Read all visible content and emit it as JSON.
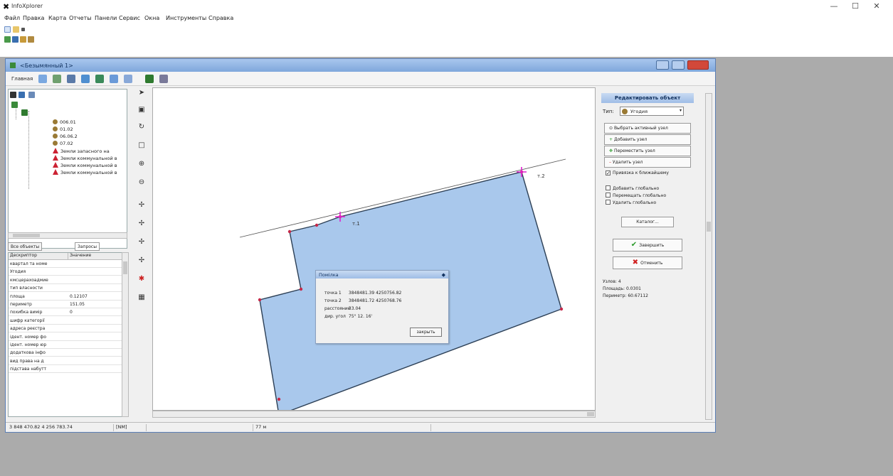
{
  "app": {
    "title": "InfoXplorer",
    "window_controls": [
      "—",
      "☐",
      "✕"
    ]
  },
  "menu": [
    "Файл",
    "Правка",
    "Карта",
    "Отчеты",
    "Панели",
    "Сервис",
    "Окна",
    "Инструменты",
    "Справка"
  ],
  "mdi": {
    "title": "<Безымянный 1>",
    "toolbar_label": "Главная"
  },
  "tree": {
    "nodes": [
      "006.01",
      "01.02",
      "06.06.2",
      "07.02",
      "Земли запасного на",
      "Земли коммунальной в",
      "Земли коммунальной в",
      "Земли коммунальной в"
    ],
    "tabs": [
      "Все объекты",
      "Запросы"
    ]
  },
  "props": {
    "headers": [
      "Дескриптор",
      "Значение"
    ],
    "rows": [
      {
        "key": "квартал та номе",
        "value": ""
      },
      {
        "key": "Угодия",
        "value": ""
      },
      {
        "key": "кмсцерахоадмие",
        "value": ""
      },
      {
        "key": "тип власности",
        "value": ""
      },
      {
        "key": "площа",
        "value": "0.12107"
      },
      {
        "key": "периметр",
        "value": "151.05"
      },
      {
        "key": "похибка вимір",
        "value": "0"
      },
      {
        "key": "шифр категорії",
        "value": ""
      },
      {
        "key": "адреса реєстра",
        "value": ""
      },
      {
        "key": "ідент. номер фо",
        "value": ""
      },
      {
        "key": "ідент. номер юр",
        "value": ""
      },
      {
        "key": "додаткова інфо",
        "value": ""
      },
      {
        "key": "вид права на д",
        "value": ""
      },
      {
        "key": "підстава набутт",
        "value": ""
      }
    ]
  },
  "map": {
    "point_labels": [
      "т.1",
      "т.2"
    ]
  },
  "measure": {
    "title": "Помiлка",
    "rows": [
      {
        "label": "точка 1",
        "value": "3848481.39 4250756.82"
      },
      {
        "label": "точка 2",
        "value": "3848481.72 4250768.76"
      },
      {
        "label": "расстояние",
        "value": "33.04"
      },
      {
        "label": "дир. угол",
        "value": "75° 12. 16'"
      }
    ],
    "button": "закрыть"
  },
  "edit_panel": {
    "title": "Редактировать объект",
    "type_label": "Тип:",
    "type_value": "Угодия",
    "node_buttons": [
      "Выбрать активный узел",
      "Добавить узел",
      "Переместить узел",
      "Удалить узел"
    ],
    "snap_label": "Привязка к ближайшему",
    "snap_checked": true,
    "global_options": [
      "Добавить глобально",
      "Перемещать глобально",
      "Удалить глобально"
    ],
    "catalog_button": "Каталог...",
    "finish_button": "Завершить",
    "cancel_button": "Отменить",
    "stats": [
      "Узлов: 4",
      "Площадь: 0.0301",
      "Периметр: 60.67112"
    ]
  },
  "status": {
    "coords": "3 848 470.82  4 256 783.74",
    "mode": "[NM]",
    "scale": "77 м"
  },
  "colors": {
    "parcel_fill": "#a9c8ec",
    "parcel_stroke": "#2c3f55",
    "vertex": "#c62848",
    "marker": "#e020d0",
    "ok": "#2a9a2a",
    "cancel": "#d02020"
  }
}
